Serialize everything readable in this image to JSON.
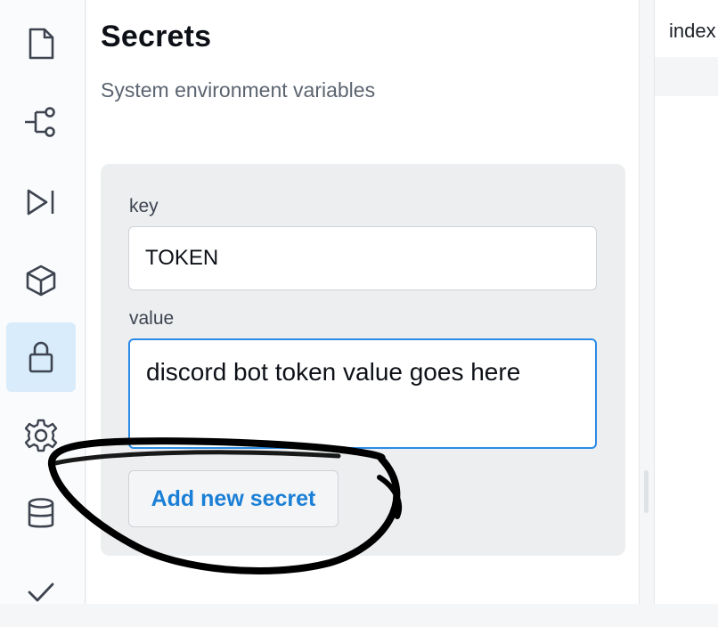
{
  "sidebar": {
    "items": [
      {
        "icon": "file-icon",
        "active": false
      },
      {
        "icon": "git-branch-icon",
        "active": false
      },
      {
        "icon": "run-icon",
        "active": false
      },
      {
        "icon": "package-icon",
        "active": false
      },
      {
        "icon": "lock-icon",
        "active": true
      },
      {
        "icon": "gear-icon",
        "active": false
      },
      {
        "icon": "database-icon",
        "active": false
      },
      {
        "icon": "check-icon",
        "active": false
      }
    ]
  },
  "panel": {
    "title": "Secrets",
    "subtitle": "System environment variables"
  },
  "form": {
    "key_label": "key",
    "key_value": "TOKEN",
    "value_label": "value",
    "value_value": "discord bot token value goes here",
    "add_button_label": "Add new secret"
  },
  "editor": {
    "tab_label": "index"
  },
  "colors": {
    "accent": "#1a7fd6",
    "focus_border": "#2b8ae6",
    "active_rail_bg": "#d8ecfb",
    "annotation_ink": "#000000"
  }
}
